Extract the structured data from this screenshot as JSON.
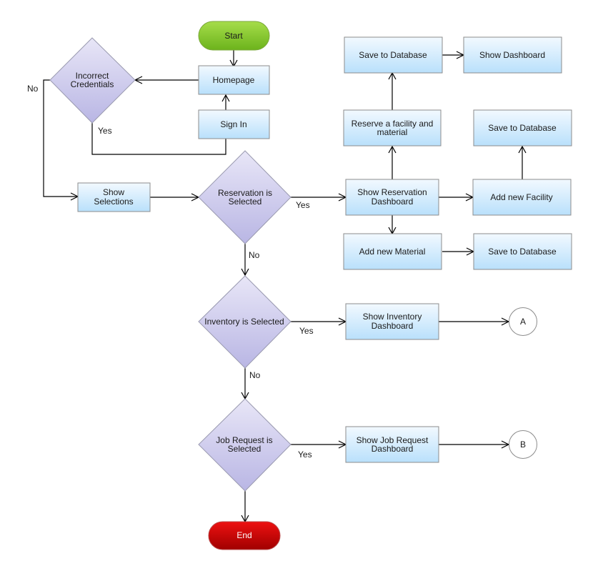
{
  "colors": {
    "start_fill_top": "#a6dd4a",
    "start_fill_bottom": "#6cb31c",
    "end_fill_top": "#ee1111",
    "end_fill_bottom": "#a00000",
    "box_fill_top": "#f2f9ff",
    "box_fill_bottom": "#b9e0fb",
    "diamond_fill_top": "#e8e6f7",
    "diamond_fill_bottom": "#b9b6e4"
  },
  "nodes": {
    "start": {
      "label": "Start"
    },
    "homepage": {
      "label": "Homepage"
    },
    "sign_in": {
      "label": "Sign In"
    },
    "incorrect_credentials": {
      "lines": [
        "Incorrect",
        "Credentials"
      ]
    },
    "show_selections": {
      "lines": [
        "Show",
        "Selections"
      ]
    },
    "reservation_selected": {
      "lines": [
        "Reservation is",
        "Selected"
      ]
    },
    "show_reservation_dashboard": {
      "lines": [
        "Show Reservation",
        "Dashboard"
      ]
    },
    "reserve_facility_material": {
      "lines": [
        "Reserve a facility and",
        "material"
      ]
    },
    "save_db_1": {
      "label": "Save to Database"
    },
    "show_dashboard": {
      "label": "Show Dashboard"
    },
    "save_db_2": {
      "label": "Save to Database"
    },
    "add_new_facility": {
      "label": "Add new Facility"
    },
    "add_new_material": {
      "label": "Add new Material"
    },
    "save_db_3": {
      "label": "Save to Database"
    },
    "inventory_selected": {
      "label": "Inventory is Selected"
    },
    "show_inventory_dashboard": {
      "lines": [
        "Show Inventory",
        "Dashboard"
      ]
    },
    "connector_a": {
      "label": "A"
    },
    "job_request_selected": {
      "lines": [
        "Job Request is",
        "Selected"
      ]
    },
    "show_job_request_dashboard": {
      "lines": [
        "Show Job Request",
        "Dashboard"
      ]
    },
    "connector_b": {
      "label": "B"
    },
    "end": {
      "label": "End"
    }
  },
  "edge_labels": {
    "credentials_no": "No",
    "credentials_yes": "Yes",
    "reservation_yes": "Yes",
    "reservation_no": "No",
    "inventory_yes": "Yes",
    "inventory_no": "No",
    "job_request_yes": "Yes"
  }
}
